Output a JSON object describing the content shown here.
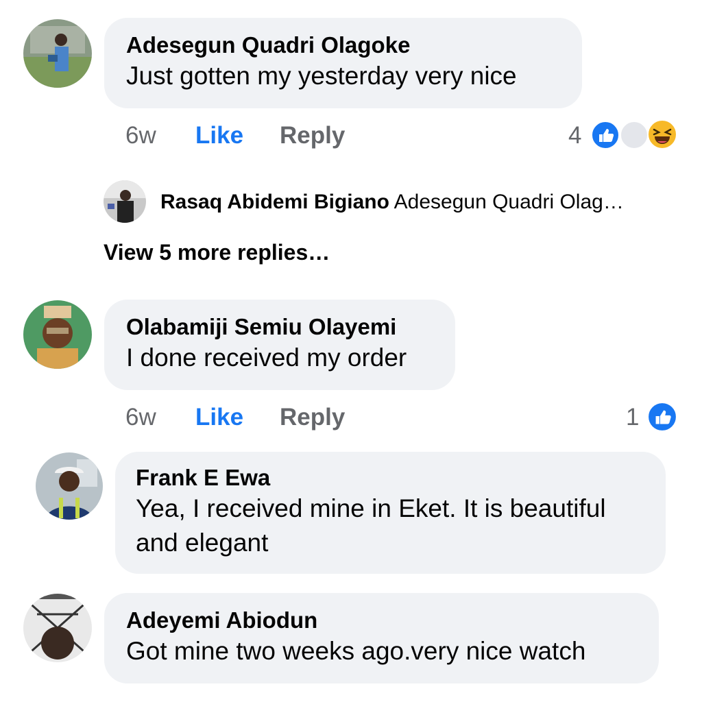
{
  "comments": [
    {
      "author": "Adesegun Quadri Olagoke",
      "text": "Just gotten my yesterday very nice",
      "time": "6w",
      "like_label": "Like",
      "reply_label": "Reply",
      "reaction_count": "4",
      "reactions": [
        "like-icon",
        "blank-reaction-icon",
        "haha-icon"
      ]
    },
    {
      "author": "Olabamiji Semiu Olayemi",
      "text": "I done received my order",
      "time": "6w",
      "like_label": "Like",
      "reply_label": "Reply",
      "reaction_count": "1",
      "reactions": [
        "like-icon"
      ]
    },
    {
      "author": "Frank E Ewa",
      "text_line1": "Yea, I received mine in Eket. It is beautiful",
      "text_line2": "and elegant"
    },
    {
      "author": "Adeyemi Abiodun",
      "text": "Got mine two weeks ago.very nice watch"
    }
  ],
  "reply_preview": {
    "author": "Rasaq Abidemi Bigiano",
    "text": "Adesegun Quadri Olag…"
  },
  "view_more": "View 5 more replies…",
  "colors": {
    "bubble": "#f0f2f5",
    "like_blue": "#1877f2",
    "meta_gray": "#65676b",
    "haha_yellow": "#f7b928"
  }
}
